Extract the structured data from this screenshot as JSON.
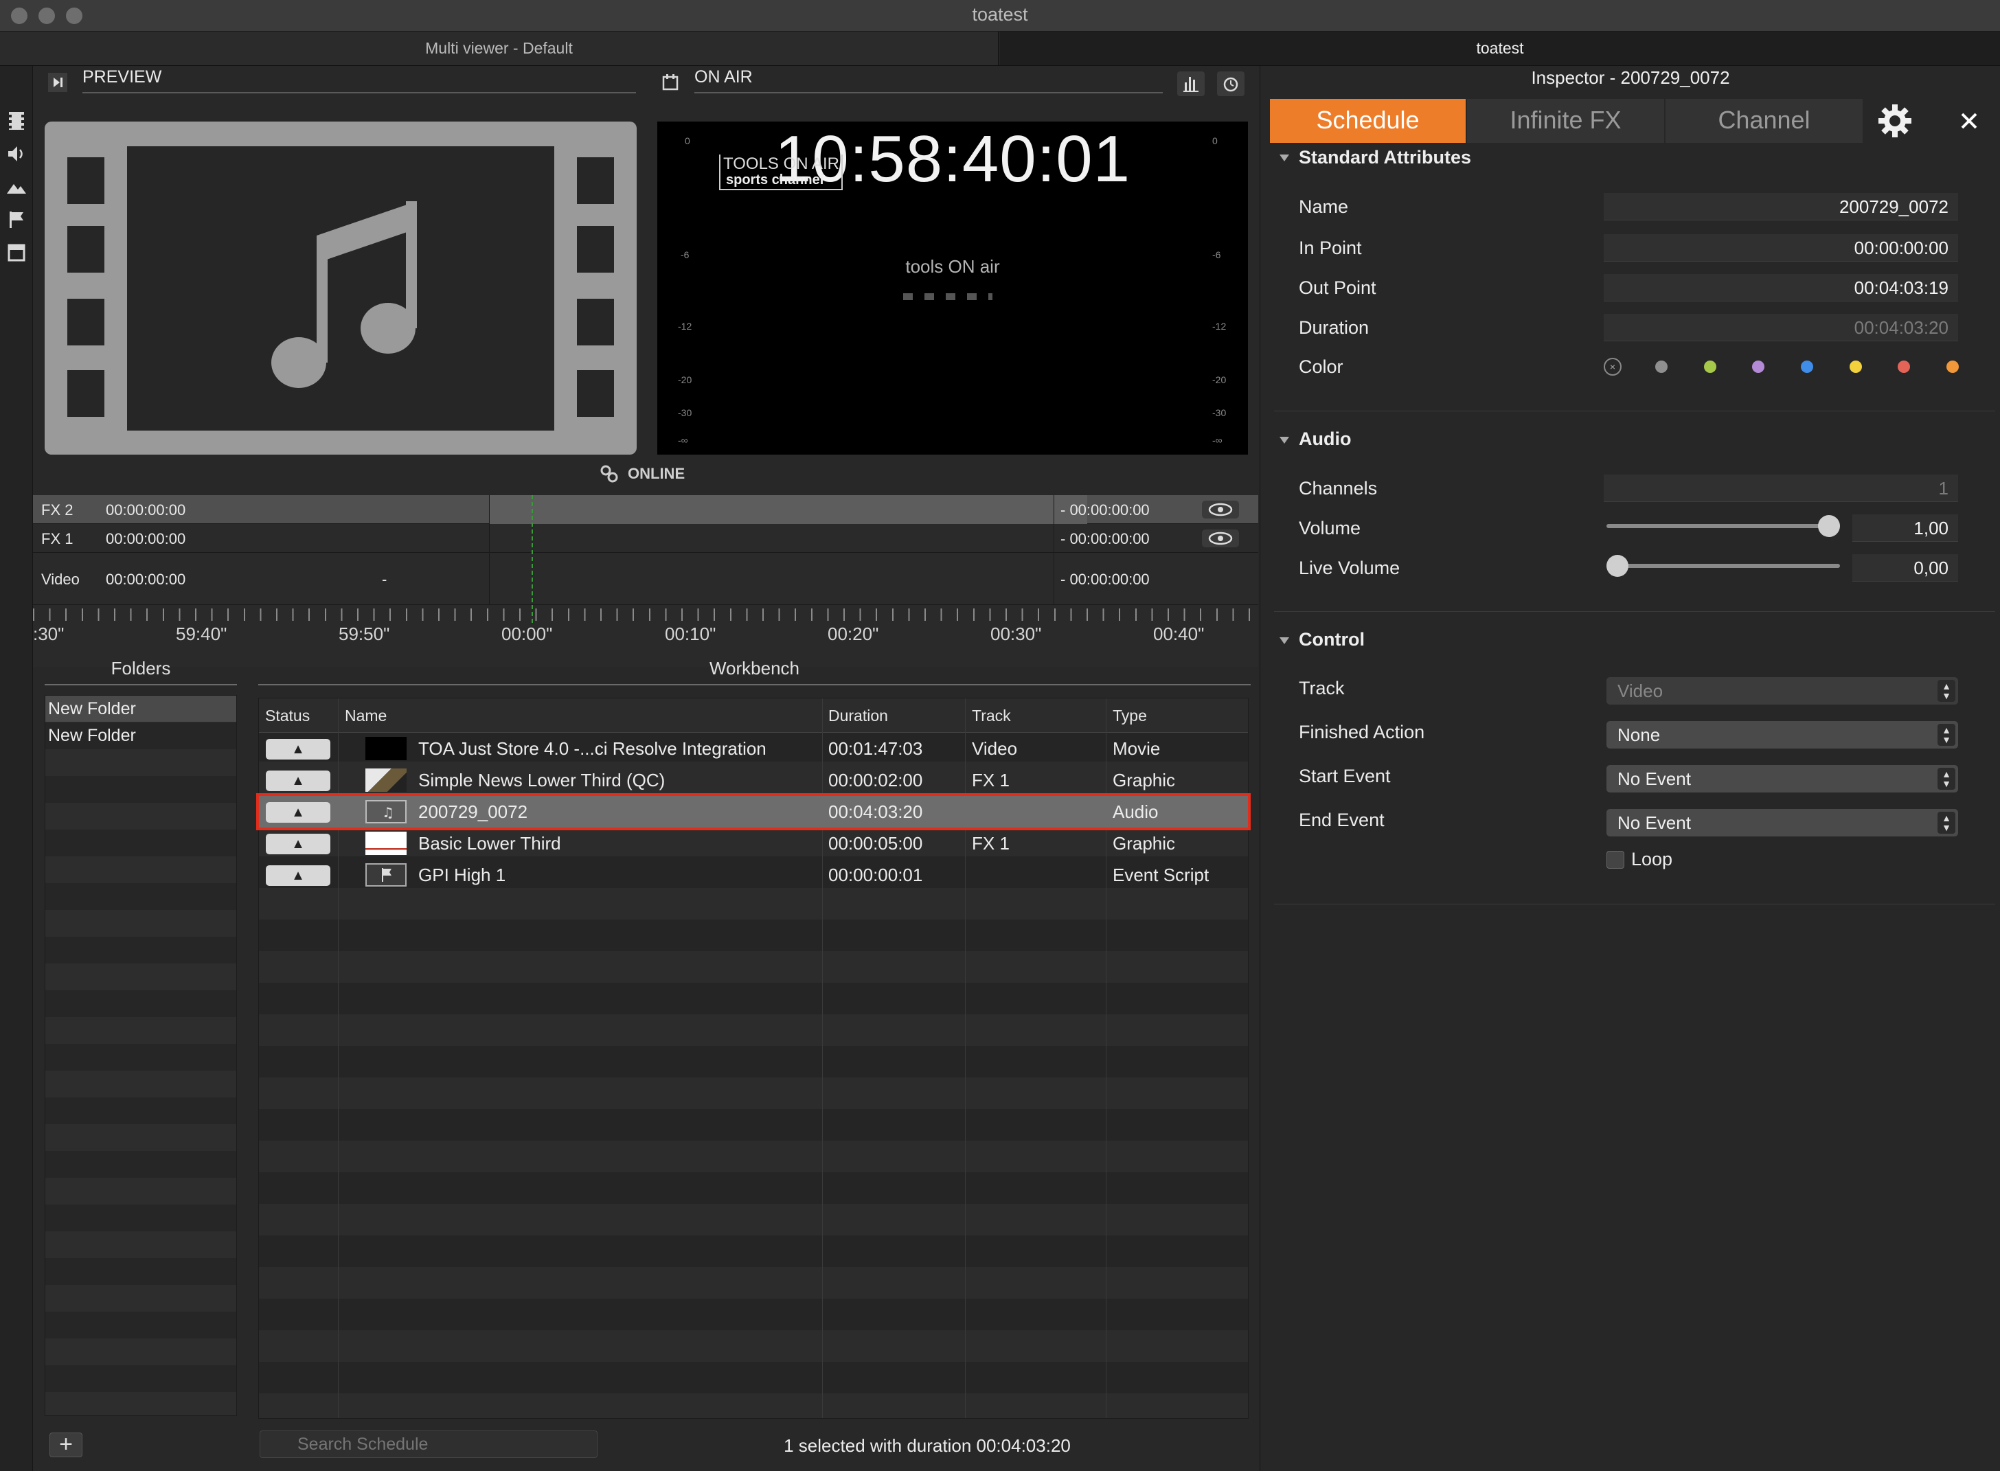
{
  "window": {
    "title": "toatest",
    "tabs": [
      "Multi viewer - Default",
      "toatest"
    ]
  },
  "preview": {
    "label": "PREVIEW"
  },
  "onair": {
    "label": "ON AIR",
    "clock": "10:58:40:01",
    "meter_left": [
      "0",
      "-6",
      "-12",
      "-20",
      "-30",
      "-∞"
    ],
    "meter_right": [
      "0",
      "-6",
      "-12",
      "-20",
      "-30",
      "-∞"
    ],
    "overlay_logo": "TOOLS ON AIR",
    "overlay_sub": "sports channel",
    "center_logo": "tools ON air",
    "status": "ONLINE"
  },
  "timeline": {
    "rows": [
      {
        "name": "FX 2",
        "start": "00:00:00:00",
        "remaining": "- 00:00:00:00"
      },
      {
        "name": "FX 1",
        "start": "00:00:00:00",
        "remaining": "- 00:00:00:00"
      },
      {
        "name": "Video",
        "start": "00:00:00:00",
        "mid": "-",
        "remaining": "- 00:00:00:00"
      }
    ],
    "ruler": [
      ":30\"",
      "59:40\"",
      "59:50\"",
      "00:00\"",
      "00:10\"",
      "00:20\"",
      "00:30\"",
      "00:40\""
    ]
  },
  "folders": {
    "title": "Folders",
    "items": [
      "New Folder",
      "New Folder"
    ]
  },
  "workbench": {
    "title": "Workbench",
    "columns": {
      "status": "Status",
      "name": "Name",
      "duration": "Duration",
      "track": "Track",
      "type": "Type"
    },
    "rows": [
      {
        "status": "▲",
        "name": "TOA Just Store 4.0 -...ci Resolve Integration",
        "duration": "00:01:47:03",
        "track": "Video",
        "type": "Movie"
      },
      {
        "status": "▲",
        "name": "Simple News Lower Third (QC)",
        "duration": "00:00:02:00",
        "track": "FX 1",
        "type": "Graphic"
      },
      {
        "status": "▲",
        "name": "200729_0072",
        "duration": "00:04:03:20",
        "track": "",
        "type": "Audio"
      },
      {
        "status": "▲",
        "name": "Basic Lower Third",
        "duration": "00:00:05:00",
        "track": "FX 1",
        "type": "Graphic"
      },
      {
        "status": "▲",
        "name": "GPI High 1",
        "duration": "00:00:00:01",
        "track": "",
        "type": "Event Script"
      }
    ],
    "search_placeholder": "Search Schedule",
    "selection_summary": "1 selected with duration 00:04:03:20",
    "add_label": "+"
  },
  "inspector": {
    "title": "Inspector - 200729_0072",
    "tabs": [
      "Schedule",
      "Infinite FX",
      "Channel"
    ],
    "accent": "#ee7d2a",
    "standard": {
      "heading": "Standard Attributes",
      "name_label": "Name",
      "name": "200729_0072",
      "in_label": "In Point",
      "in": "00:00:00:00",
      "out_label": "Out Point",
      "out": "00:04:03:19",
      "duration_label": "Duration",
      "duration": "00:04:03:20",
      "color_label": "Color",
      "colors": [
        "#8f8f8f",
        "#a6c94a",
        "#b48ad6",
        "#3f8de8",
        "#f2d13c",
        "#e46458",
        "#f0983a"
      ]
    },
    "audio": {
      "heading": "Audio",
      "channels_label": "Channels",
      "channels": "1",
      "volume_label": "Volume",
      "volume": "1,00",
      "volume_level": 1.0,
      "live_label": "Live Volume",
      "live": "0,00",
      "live_level": 0.0
    },
    "control": {
      "heading": "Control",
      "track_label": "Track",
      "track": "Video",
      "finished_label": "Finished Action",
      "finished": "None",
      "start_label": "Start Event",
      "start": "No Event",
      "end_label": "End Event",
      "end": "No Event",
      "loop_label": "Loop"
    }
  }
}
